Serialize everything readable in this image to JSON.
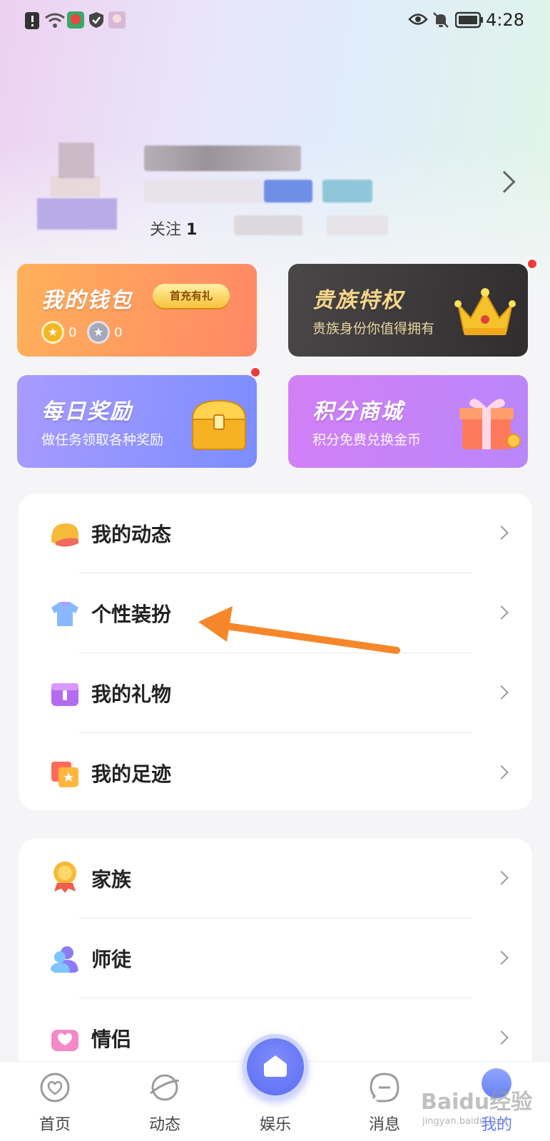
{
  "status_bar": {
    "time": "4:28"
  },
  "profile": {
    "follow_label": "关注",
    "follow_count": "1"
  },
  "cards": {
    "wallet": {
      "title": "我的钱包",
      "badge": "首充有礼",
      "gold_value": "0",
      "silver_value": "0"
    },
    "noble": {
      "title": "贵族特权",
      "subtitle": "贵族身份你值得拥有"
    },
    "daily": {
      "title": "每日奖励",
      "subtitle": "做任务领取各种奖励"
    },
    "mall": {
      "title": "积分商城",
      "subtitle": "积分免费兑换金币"
    }
  },
  "menu_group_1": [
    {
      "label": "我的动态",
      "icon": "helmet-icon"
    },
    {
      "label": "个性装扮",
      "icon": "shirt-icon"
    },
    {
      "label": "我的礼物",
      "icon": "gift-box-icon"
    },
    {
      "label": "我的足迹",
      "icon": "footprint-icon"
    }
  ],
  "menu_group_2": [
    {
      "label": "家族",
      "icon": "medal-icon"
    },
    {
      "label": "师徒",
      "icon": "mentor-icon"
    },
    {
      "label": "情侣",
      "icon": "couple-icon"
    }
  ],
  "tabbar": {
    "home": "首页",
    "feed": "动态",
    "entertainment": "娱乐",
    "messages": "消息",
    "mine": "我的"
  },
  "watermark": {
    "text": "Baidu经验",
    "url_text": "jingyan.baidu.com"
  },
  "colors": {
    "wallet_gradient": "#ffa45c",
    "noble_gradient": "#3f3d3e",
    "daily_gradient": "#8093ff",
    "mall_gradient": "#c97cf8",
    "arrow": "#f5872a"
  }
}
